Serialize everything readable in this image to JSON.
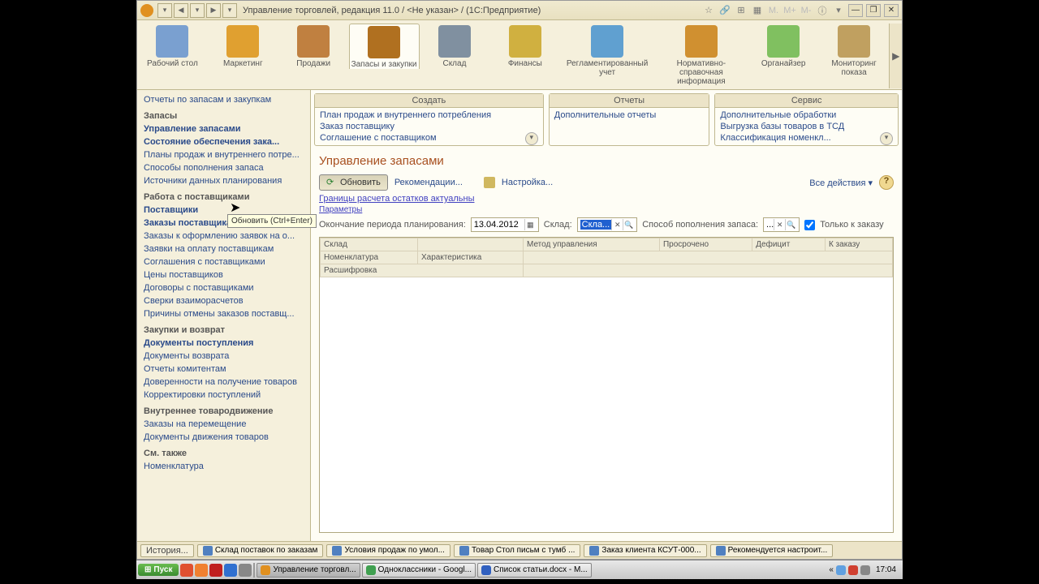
{
  "title": "Управление торговлей, редакция 11.0 / <Не указан> / (1С:Предприятие)",
  "sections": [
    {
      "label": "Рабочий стол"
    },
    {
      "label": "Маркетинг"
    },
    {
      "label": "Продажи"
    },
    {
      "label": "Запасы и закупки",
      "active": true
    },
    {
      "label": "Склад"
    },
    {
      "label": "Финансы"
    },
    {
      "label": "Регламентированный учет"
    },
    {
      "label": "Нормативно-справочная информация"
    },
    {
      "label": "Органайзер"
    },
    {
      "label": "Мониторинг показа"
    }
  ],
  "sidebar": [
    {
      "type": "link",
      "label": "Отчеты по запасам и закупкам"
    },
    {
      "type": "cat",
      "label": "Запасы"
    },
    {
      "type": "link",
      "bold": true,
      "label": "Управление запасами"
    },
    {
      "type": "link",
      "bold": true,
      "label": "Состояние обеспечения зака..."
    },
    {
      "type": "link",
      "label": "Планы продаж и внутреннего потре..."
    },
    {
      "type": "link",
      "label": "Способы пополнения запаса"
    },
    {
      "type": "link",
      "label": "Источники данных планирования"
    },
    {
      "type": "cat",
      "label": "Работа с поставщиками"
    },
    {
      "type": "link",
      "bold": true,
      "label": "Поставщики"
    },
    {
      "type": "link",
      "bold": true,
      "label": "Заказы поставщикам"
    },
    {
      "type": "link",
      "label": "Заказы к оформлению заявок на о..."
    },
    {
      "type": "link",
      "label": "Заявки на оплату поставщикам"
    },
    {
      "type": "link",
      "label": "Соглашения с поставщиками"
    },
    {
      "type": "link",
      "label": "Цены поставщиков"
    },
    {
      "type": "link",
      "label": "Договоры с поставщиками"
    },
    {
      "type": "link",
      "label": "Сверки взаиморасчетов"
    },
    {
      "type": "link",
      "label": "Причины отмены заказов поставщ..."
    },
    {
      "type": "cat",
      "label": "Закупки и возврат"
    },
    {
      "type": "link",
      "bold": true,
      "label": "Документы поступления"
    },
    {
      "type": "link",
      "label": "Документы возврата"
    },
    {
      "type": "link",
      "label": "Отчеты комитентам"
    },
    {
      "type": "link",
      "label": "Доверенности на получение товаров"
    },
    {
      "type": "link",
      "label": "Корректировки поступлений"
    },
    {
      "type": "cat",
      "label": "Внутреннее товародвижение"
    },
    {
      "type": "link",
      "label": "Заказы на перемещение"
    },
    {
      "type": "link",
      "label": "Документы движения товаров"
    },
    {
      "type": "cat",
      "label": "См. также"
    },
    {
      "type": "link",
      "label": "Номенклатура"
    }
  ],
  "panels": {
    "create": {
      "title": "Создать",
      "items": [
        "План продаж и внутреннего потребления",
        "Заказ поставщику",
        "Соглашение с поставщиком"
      ]
    },
    "reports": {
      "title": "Отчеты",
      "items": [
        "Дополнительные отчеты"
      ]
    },
    "service": {
      "title": "Сервис",
      "items": [
        "Дополнительные обработки",
        "Выгрузка базы товаров в ТСД",
        "Классификация номенкл..."
      ]
    }
  },
  "page": {
    "title": "Управление запасами",
    "btn_refresh": "Обновить",
    "link_hints": "Рекомендации...",
    "link_settings": "Настройка...",
    "all_actions": "Все действия",
    "status": "Границы расчета остатков актуальны",
    "params": "Параметры",
    "tooltip": "Обновить (Ctrl+Enter)"
  },
  "filter": {
    "period_lbl": "Окончание периода планирования:",
    "period_val": "13.04.2012",
    "warehouse_lbl": "Склад:",
    "warehouse_val": "Скла...",
    "method_lbl": "Способ пополнения запаса:",
    "method_val": "...",
    "only_order": "Только к заказу"
  },
  "table": {
    "cols": [
      "Склад",
      "Метод управления",
      "Просрочено",
      "Дефицит",
      "К заказу"
    ],
    "subcols": [
      "Номенклатура",
      "Характеристика"
    ],
    "row3": "Расшифровка"
  },
  "bottom_bar": {
    "history": "История...",
    "tabs": [
      "Склад поставок по заказам",
      "Условия продаж по умол...",
      "Товар Стол письм с тумб ...",
      "Заказ клиента КСУТ-000...",
      "Рекомендуется настроит..."
    ]
  },
  "taskbar": {
    "start": "Пуск",
    "tasks": [
      {
        "label": "Управление торговл...",
        "active": true
      },
      {
        "label": "Одноклассники - Googl..."
      },
      {
        "label": "Список статьи.docx - M..."
      }
    ],
    "clock": "17:04"
  }
}
